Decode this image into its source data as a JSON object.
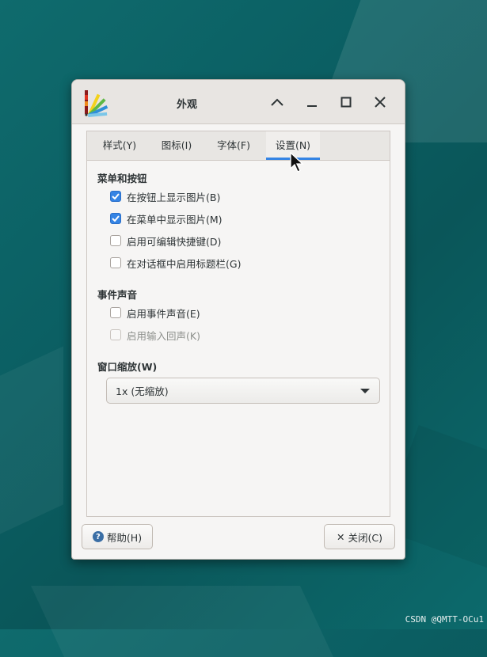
{
  "window": {
    "title": "外观"
  },
  "tabs": [
    {
      "label": "样式(Y)"
    },
    {
      "label": "图标(I)"
    },
    {
      "label": "字体(F)"
    },
    {
      "label": "设置(N)",
      "active": true
    }
  ],
  "sections": {
    "menus_buttons": {
      "title": "菜单和按钮",
      "items": [
        {
          "label": "在按钮上显示图片(B)",
          "checked": true
        },
        {
          "label": "在菜单中显示图片(M)",
          "checked": true
        },
        {
          "label": "启用可编辑快捷键(D)",
          "checked": false
        },
        {
          "label": "在对话框中启用标题栏(G)",
          "checked": false
        }
      ]
    },
    "event_sounds": {
      "title": "事件声音",
      "items": [
        {
          "label": "启用事件声音(E)",
          "checked": false
        },
        {
          "label": "启用输入回声(K)",
          "checked": false,
          "disabled": true
        }
      ]
    },
    "scaling": {
      "title": "窗口缩放(W)",
      "selected": "1x (无缩放)"
    }
  },
  "buttons": {
    "help": "帮助(H)",
    "close": "关闭(C)"
  },
  "watermark": "CSDN @QMTT-OCu1",
  "colors": {
    "accent": "#3584e4",
    "desktop": "#0b5f63"
  }
}
